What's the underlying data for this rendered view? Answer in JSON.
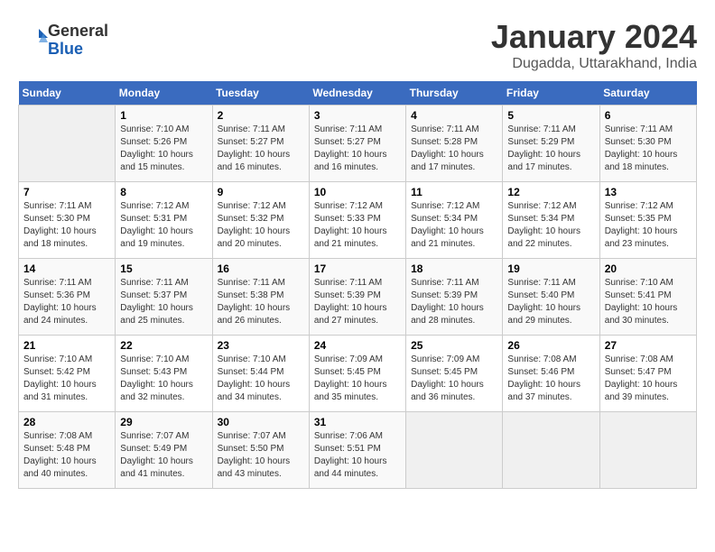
{
  "header": {
    "logo_line1": "General",
    "logo_line2": "Blue",
    "title": "January 2024",
    "subtitle": "Dugadda, Uttarakhand, India"
  },
  "columns": [
    "Sunday",
    "Monday",
    "Tuesday",
    "Wednesday",
    "Thursday",
    "Friday",
    "Saturday"
  ],
  "weeks": [
    [
      {
        "day": "",
        "info": ""
      },
      {
        "day": "1",
        "info": "Sunrise: 7:10 AM\nSunset: 5:26 PM\nDaylight: 10 hours\nand 15 minutes."
      },
      {
        "day": "2",
        "info": "Sunrise: 7:11 AM\nSunset: 5:27 PM\nDaylight: 10 hours\nand 16 minutes."
      },
      {
        "day": "3",
        "info": "Sunrise: 7:11 AM\nSunset: 5:27 PM\nDaylight: 10 hours\nand 16 minutes."
      },
      {
        "day": "4",
        "info": "Sunrise: 7:11 AM\nSunset: 5:28 PM\nDaylight: 10 hours\nand 17 minutes."
      },
      {
        "day": "5",
        "info": "Sunrise: 7:11 AM\nSunset: 5:29 PM\nDaylight: 10 hours\nand 17 minutes."
      },
      {
        "day": "6",
        "info": "Sunrise: 7:11 AM\nSunset: 5:30 PM\nDaylight: 10 hours\nand 18 minutes."
      }
    ],
    [
      {
        "day": "7",
        "info": "Sunrise: 7:11 AM\nSunset: 5:30 PM\nDaylight: 10 hours\nand 18 minutes."
      },
      {
        "day": "8",
        "info": "Sunrise: 7:12 AM\nSunset: 5:31 PM\nDaylight: 10 hours\nand 19 minutes."
      },
      {
        "day": "9",
        "info": "Sunrise: 7:12 AM\nSunset: 5:32 PM\nDaylight: 10 hours\nand 20 minutes."
      },
      {
        "day": "10",
        "info": "Sunrise: 7:12 AM\nSunset: 5:33 PM\nDaylight: 10 hours\nand 21 minutes."
      },
      {
        "day": "11",
        "info": "Sunrise: 7:12 AM\nSunset: 5:34 PM\nDaylight: 10 hours\nand 21 minutes."
      },
      {
        "day": "12",
        "info": "Sunrise: 7:12 AM\nSunset: 5:34 PM\nDaylight: 10 hours\nand 22 minutes."
      },
      {
        "day": "13",
        "info": "Sunrise: 7:12 AM\nSunset: 5:35 PM\nDaylight: 10 hours\nand 23 minutes."
      }
    ],
    [
      {
        "day": "14",
        "info": "Sunrise: 7:11 AM\nSunset: 5:36 PM\nDaylight: 10 hours\nand 24 minutes."
      },
      {
        "day": "15",
        "info": "Sunrise: 7:11 AM\nSunset: 5:37 PM\nDaylight: 10 hours\nand 25 minutes."
      },
      {
        "day": "16",
        "info": "Sunrise: 7:11 AM\nSunset: 5:38 PM\nDaylight: 10 hours\nand 26 minutes."
      },
      {
        "day": "17",
        "info": "Sunrise: 7:11 AM\nSunset: 5:39 PM\nDaylight: 10 hours\nand 27 minutes."
      },
      {
        "day": "18",
        "info": "Sunrise: 7:11 AM\nSunset: 5:39 PM\nDaylight: 10 hours\nand 28 minutes."
      },
      {
        "day": "19",
        "info": "Sunrise: 7:11 AM\nSunset: 5:40 PM\nDaylight: 10 hours\nand 29 minutes."
      },
      {
        "day": "20",
        "info": "Sunrise: 7:10 AM\nSunset: 5:41 PM\nDaylight: 10 hours\nand 30 minutes."
      }
    ],
    [
      {
        "day": "21",
        "info": "Sunrise: 7:10 AM\nSunset: 5:42 PM\nDaylight: 10 hours\nand 31 minutes."
      },
      {
        "day": "22",
        "info": "Sunrise: 7:10 AM\nSunset: 5:43 PM\nDaylight: 10 hours\nand 32 minutes."
      },
      {
        "day": "23",
        "info": "Sunrise: 7:10 AM\nSunset: 5:44 PM\nDaylight: 10 hours\nand 34 minutes."
      },
      {
        "day": "24",
        "info": "Sunrise: 7:09 AM\nSunset: 5:45 PM\nDaylight: 10 hours\nand 35 minutes."
      },
      {
        "day": "25",
        "info": "Sunrise: 7:09 AM\nSunset: 5:45 PM\nDaylight: 10 hours\nand 36 minutes."
      },
      {
        "day": "26",
        "info": "Sunrise: 7:08 AM\nSunset: 5:46 PM\nDaylight: 10 hours\nand 37 minutes."
      },
      {
        "day": "27",
        "info": "Sunrise: 7:08 AM\nSunset: 5:47 PM\nDaylight: 10 hours\nand 39 minutes."
      }
    ],
    [
      {
        "day": "28",
        "info": "Sunrise: 7:08 AM\nSunset: 5:48 PM\nDaylight: 10 hours\nand 40 minutes."
      },
      {
        "day": "29",
        "info": "Sunrise: 7:07 AM\nSunset: 5:49 PM\nDaylight: 10 hours\nand 41 minutes."
      },
      {
        "day": "30",
        "info": "Sunrise: 7:07 AM\nSunset: 5:50 PM\nDaylight: 10 hours\nand 43 minutes."
      },
      {
        "day": "31",
        "info": "Sunrise: 7:06 AM\nSunset: 5:51 PM\nDaylight: 10 hours\nand 44 minutes."
      },
      {
        "day": "",
        "info": ""
      },
      {
        "day": "",
        "info": ""
      },
      {
        "day": "",
        "info": ""
      }
    ]
  ]
}
